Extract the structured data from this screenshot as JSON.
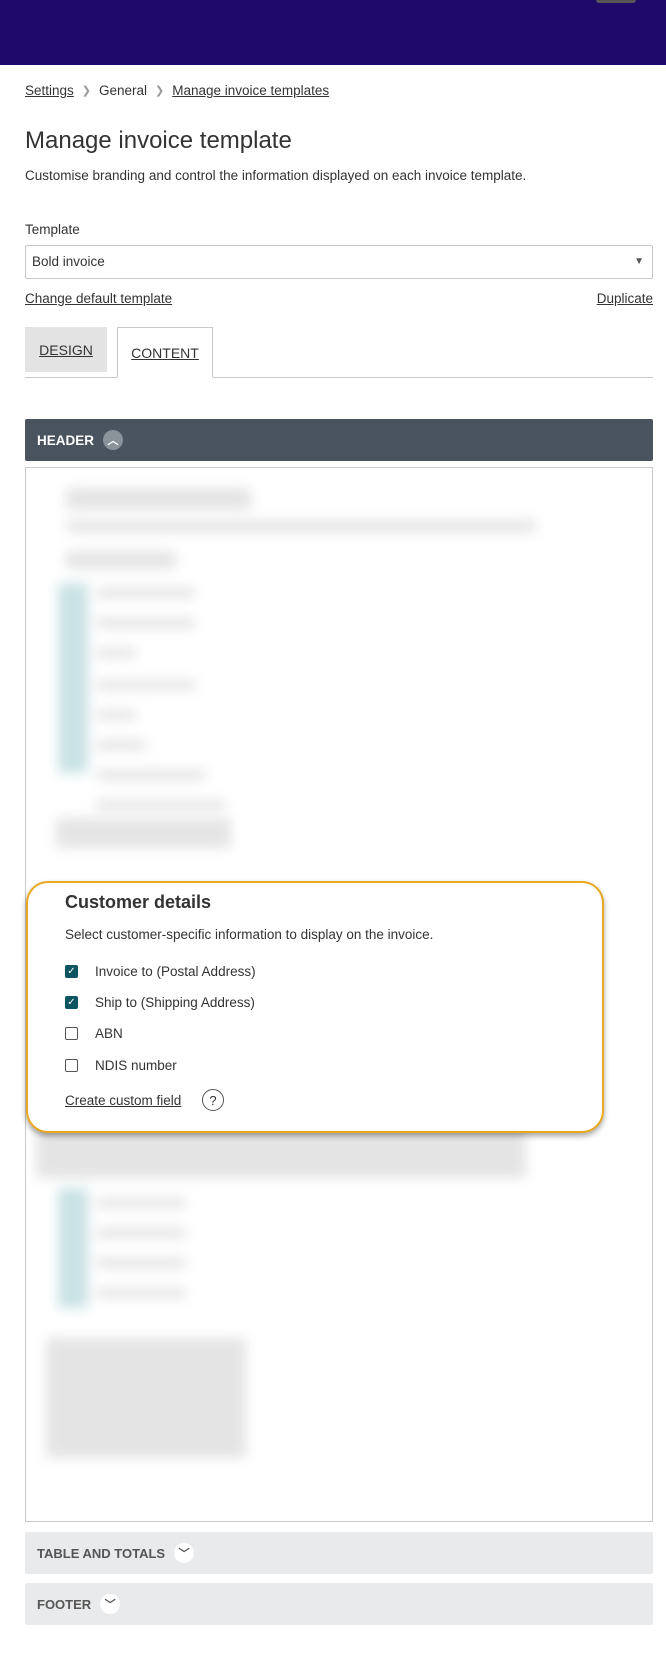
{
  "breadcrumb": {
    "items": [
      {
        "label": "Settings",
        "link": true
      },
      {
        "label": "General",
        "link": false
      },
      {
        "label": "Manage invoice templates",
        "link": true
      }
    ],
    "separator_icon": "chevron-right-icon"
  },
  "page": {
    "title": "Manage invoice template",
    "description": "Customise branding and control the information displayed on each invoice template."
  },
  "template_field": {
    "label": "Template",
    "value": "Bold invoice",
    "arrow_icon": "▼"
  },
  "links": {
    "change_default": "Change default template",
    "duplicate": "Duplicate"
  },
  "tabs": [
    {
      "label": "DESIGN",
      "active": false
    },
    {
      "label": "CONTENT",
      "active": true
    }
  ],
  "sections": {
    "header": {
      "label": "HEADER",
      "expanded": true,
      "icon": "chevron-up-icon"
    },
    "table_totals": {
      "label": "TABLE AND TOTALS",
      "expanded": false,
      "icon": "chevron-down-icon"
    },
    "footer": {
      "label": "FOOTER",
      "expanded": false,
      "icon": "chevron-down-icon"
    }
  },
  "customer_details": {
    "title": "Customer details",
    "description": "Select customer-specific information to display on the invoice.",
    "options": [
      {
        "label": "Invoice to (Postal Address)",
        "checked": true
      },
      {
        "label": "Ship to (Shipping Address)",
        "checked": true
      },
      {
        "label": "ABN",
        "checked": false
      },
      {
        "label": "NDIS number",
        "checked": false
      }
    ],
    "create_custom_field": "Create custom field",
    "help_symbol": "?"
  },
  "colors": {
    "topbar": "#1f0a6b",
    "section_header": "#4a545e",
    "checkbox_checked": "#0d5560",
    "highlight_border": "#e8a820"
  }
}
